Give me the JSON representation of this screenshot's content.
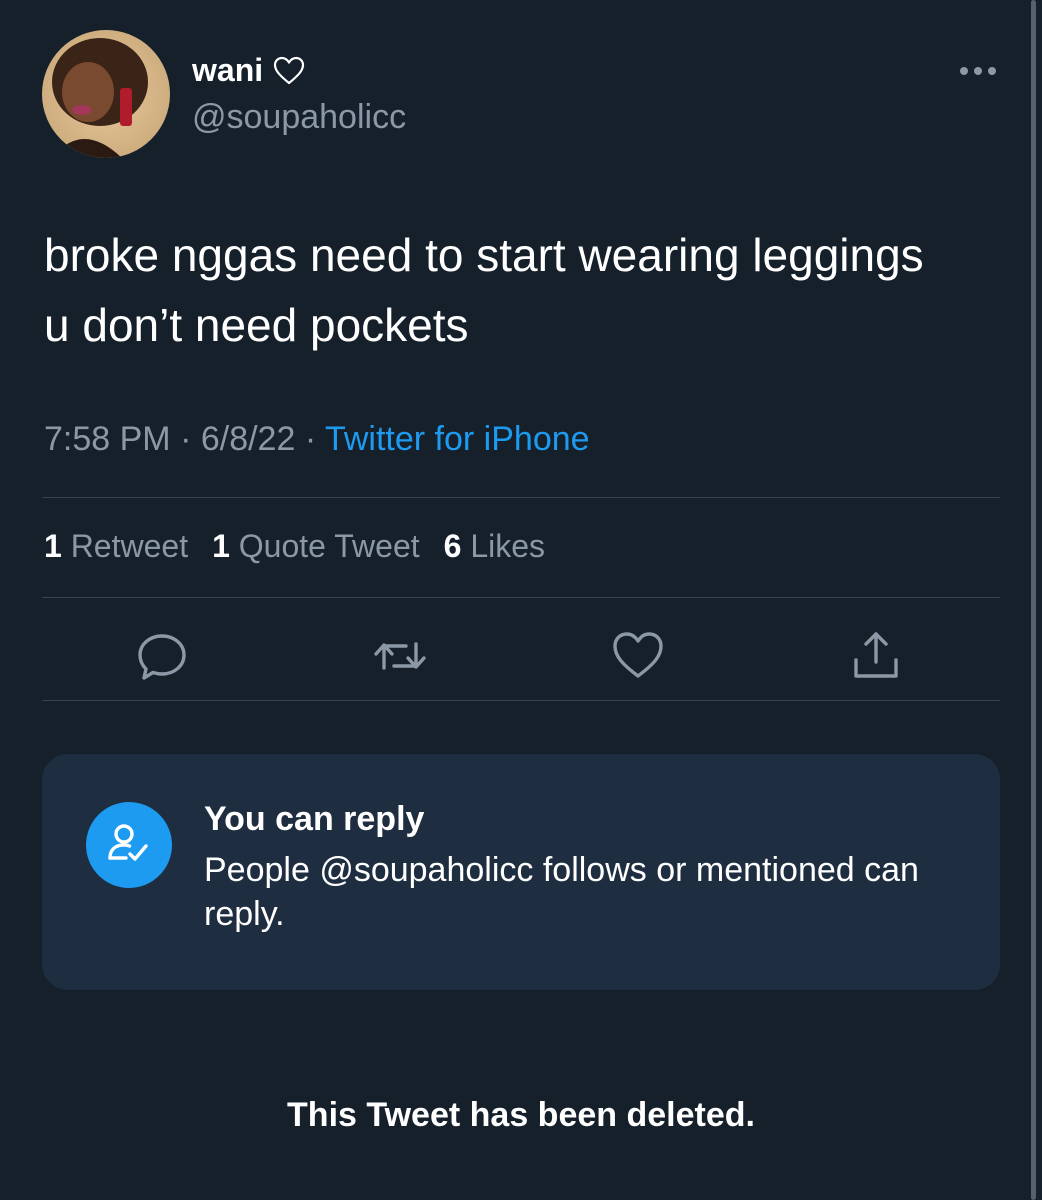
{
  "tweet": {
    "author_name": "wani",
    "author_handle": "@soupaholicc",
    "text": "broke nggas need to start wearing leggings u don’t need pockets",
    "time": "7:58 PM",
    "date": "6/8/22",
    "separator": " · ",
    "source": "Twitter for iPhone"
  },
  "stats": {
    "retweets_count": "1",
    "retweets_label": "Retweet",
    "quotes_count": "1",
    "quotes_label": "Quote Tweet",
    "likes_count": "6",
    "likes_label": "Likes"
  },
  "reply_restriction": {
    "title": "You can reply",
    "body": "People @soupaholicc follows or mentioned can reply."
  },
  "footer": {
    "deleted_notice": "This Tweet has been deleted."
  },
  "icons": {
    "name_badge": "heart-outline-icon",
    "more": "more-dots-icon",
    "reply": "reply-icon",
    "retweet": "retweet-icon",
    "like": "heart-icon",
    "share": "share-icon",
    "reply_permission": "user-check-icon"
  },
  "colors": {
    "background": "#15202b",
    "accent": "#1d9bf0",
    "secondary_text": "#8b98a5",
    "card": "#1e2e40",
    "divider": "#38444d"
  }
}
